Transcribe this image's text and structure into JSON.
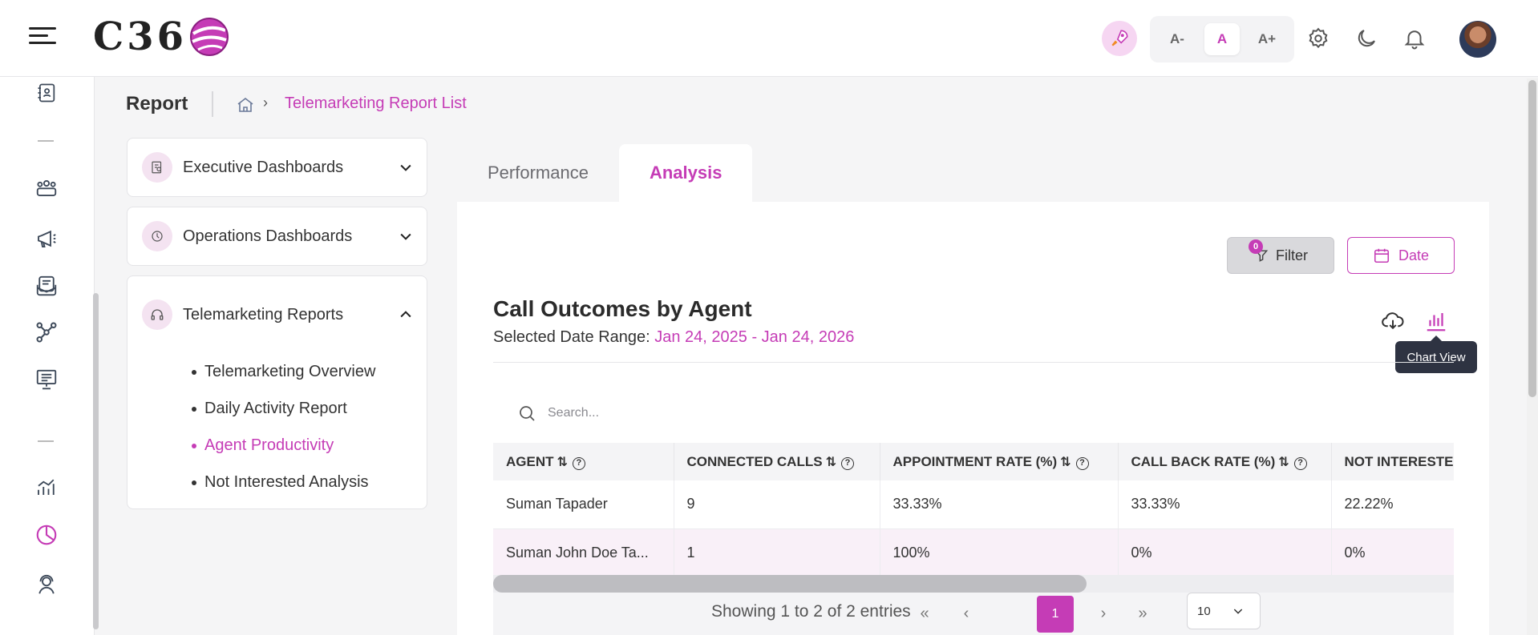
{
  "app": {
    "logo_text": "C36"
  },
  "topbar": {
    "font_small": "A-",
    "font_normal": "A",
    "font_large": "A+"
  },
  "header": {
    "title": "Report",
    "breadcrumb_current": "Telemarketing Report List"
  },
  "menu": {
    "executive": "Executive Dashboards",
    "operations": "Operations Dashboards",
    "telemarketing": "Telemarketing Reports",
    "sub_items": [
      "Telemarketing Overview",
      "Daily Activity Report",
      "Agent Productivity",
      "Not Interested Analysis"
    ],
    "active_index": 2
  },
  "tabs": [
    {
      "label": "Performance",
      "active": false
    },
    {
      "label": "Analysis",
      "active": true
    }
  ],
  "toolbar": {
    "filter_label": "Filter",
    "filter_count": "0",
    "date_label": "Date",
    "tooltip": "Chart View"
  },
  "report": {
    "title": "Call Outcomes by Agent",
    "range_label": "Selected Date Range:",
    "range_value": "Jan 24, 2025 - Jan 24, 2026"
  },
  "search": {
    "placeholder": "Search..."
  },
  "table": {
    "columns": [
      "AGENT",
      "CONNECTED CALLS",
      "APPOINTMENT RATE (%)",
      "CALL BACK RATE (%)",
      "NOT INTERESTED"
    ],
    "rows": [
      [
        "Suman Tapader",
        "9",
        "33.33%",
        "33.33%",
        "22.22%"
      ],
      [
        "Suman John Doe Ta...",
        "1",
        "100%",
        "0%",
        "0%"
      ]
    ]
  },
  "pagination": {
    "summary": "Showing 1 to 2 of 2 entries",
    "current_page": "1",
    "page_size": "10"
  },
  "colors": {
    "accent": "#c53cb6",
    "tooltip_bg": "#2e3342"
  }
}
